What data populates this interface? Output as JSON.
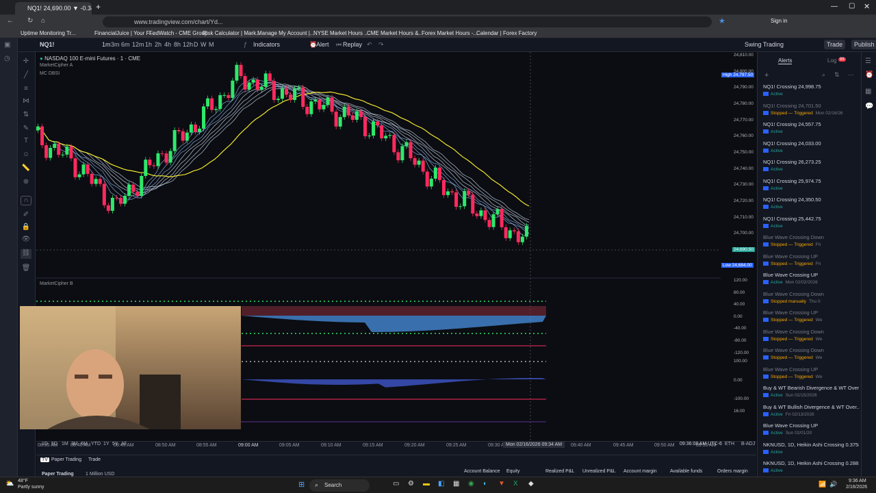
{
  "browser": {
    "tab_title": "NQ1! 24,690.00 ▼ -0.34% Swi...",
    "url": "www.tradingview.com/chart/Yd...",
    "bookmarks": [
      "Uptime Monitoring Tr...",
      "FinancialJuice | Your Fi...",
      "FedWatch - CME Group",
      "Risk Calculator | Mark...",
      "Manage My Account |...",
      "NYSE Market Hours ...",
      "CME Market Hours &...",
      "Forex Market Hours -...",
      "Calendar | Forex Factory"
    ],
    "signin": "Sign in"
  },
  "toolbar": {
    "symbol": "NQ1!",
    "timeframes": [
      "1m",
      "3m",
      "6m",
      "12m",
      "1h",
      "2h",
      "4h",
      "8h",
      "12h",
      "D",
      "W",
      "M"
    ],
    "indicators": "Indicators",
    "alert": "Alert",
    "replay": "Replay",
    "layout_name": "Swing Trading",
    "trade": "Trade",
    "publish": "Publish"
  },
  "chart": {
    "title": "NASDAQ 100 E-mini Futures · 1 · CME",
    "indicator_a": "MarketCipher A",
    "indicator_mc": "MC DBSI",
    "indicator_b": "MarketCipher B",
    "price_labels": [
      "24,810.00",
      "24,800.00",
      "24,790.00",
      "24,780.00",
      "24,770.00",
      "24,760.00",
      "24,750.00",
      "24,740.00",
      "24,730.00",
      "24,720.00",
      "24,710.00",
      "24,700.00",
      "24,690.00",
      "24,684.00"
    ],
    "high_label": "High",
    "high_value": "24,797.50",
    "low_label": "Low",
    "low_value": "24,684.00",
    "current_price": "24,690.50",
    "osc_labels": [
      "120.00",
      "80.00",
      "40.00",
      "0.00",
      "-40.00",
      "-80.00",
      "-120.00",
      "100.00",
      "0.00",
      "-100.00",
      "16.00"
    ],
    "time_labels": [
      "08:35 AM",
      "08:40 AM",
      "08:45 AM",
      "08:50 AM",
      "08:55 AM",
      "09:00 AM",
      "09:05 AM",
      "09:10 AM",
      "09:15 AM",
      "09:20 AM",
      "09:25 AM",
      "09:30 AM",
      "09:40 AM",
      "09:45 AM",
      "09:50 AM",
      "09:55 AM"
    ],
    "crosshair_time": "Mon 02/16/2026   09:34 AM",
    "clock": "09:36:08 AM UTC-6",
    "session": "ETH",
    "adj": "B-ADJ"
  },
  "chart_data": {
    "type": "line",
    "title": "NASDAQ 100 E-mini Futures · 1 · CME",
    "x": [
      "08:35",
      "08:40",
      "08:45",
      "08:50",
      "08:55",
      "09:00",
      "09:05",
      "09:10",
      "09:15",
      "09:20",
      "09:25",
      "09:30",
      "09:34"
    ],
    "series": [
      {
        "name": "NQ1!",
        "values": [
          24760,
          24742,
          24712,
          24745,
          24770,
          24800,
          24790,
          24780,
          24770,
          24750,
          24724,
          24706,
          24690
        ]
      }
    ],
    "ylim": [
      24680,
      24815
    ]
  },
  "bottom": {
    "ranges": [
      "1D",
      "5D",
      "1M",
      "3M",
      "6M",
      "YTD",
      "1Y",
      "5Y",
      "All"
    ],
    "paper_trading": "Paper Trading",
    "trade_tab": "Trade",
    "account_cols": [
      "Account Balance",
      "Equity",
      "Realized P&L",
      "Unrealized P&L",
      "Account margin",
      "Available funds",
      "Orders margin"
    ],
    "account_name": "Paper Trading",
    "account_sub": "1 Million USD"
  },
  "alerts_panel": {
    "tab_alerts": "Alerts",
    "tab_log": "Log",
    "items": [
      {
        "title": "NQ1! Crossing 24,998.75",
        "status": "Active",
        "dim": false,
        "date": ""
      },
      {
        "title": "NQ1! Crossing 24,701.50",
        "status": "Stopped — Triggered",
        "dim": true,
        "date": "Mon 02/16/26"
      },
      {
        "title": "NQ1! Crossing 24,557.75",
        "status": "Active",
        "dim": false,
        "date": ""
      },
      {
        "title": "NQ1! Crossing 24,033.00",
        "status": "Active",
        "dim": false,
        "date": ""
      },
      {
        "title": "NQ1! Crossing 26,273.25",
        "status": "Active",
        "dim": false,
        "date": ""
      },
      {
        "title": "NQ1! Crossing 25,974.75",
        "status": "Active",
        "dim": false,
        "date": ""
      },
      {
        "title": "NQ1! Crossing 24,350.50",
        "status": "Active",
        "dim": false,
        "date": ""
      },
      {
        "title": "NQ1! Crossing 25,442.75",
        "status": "Active",
        "dim": false,
        "date": ""
      },
      {
        "title": "Blue Wave Crossing Down",
        "status": "Stopped — Triggered",
        "dim": true,
        "date": "Fri"
      },
      {
        "title": "Blue Wave Crossing UP",
        "status": "Stopped — Triggered",
        "dim": true,
        "date": "Fri"
      },
      {
        "title": "Blue Wave Crossing UP",
        "status": "Active",
        "dim": false,
        "date": "Mon 02/02/2026"
      },
      {
        "title": "Blue Wave Crossing Down",
        "status": "Stopped manually",
        "dim": true,
        "date": "Thu 0"
      },
      {
        "title": "Blue Wave Crossing UP",
        "status": "Stopped — Triggered",
        "dim": true,
        "date": "We"
      },
      {
        "title": "Blue Wave Crossing Down",
        "status": "Stopped — Triggered",
        "dim": true,
        "date": "We"
      },
      {
        "title": "Blue Wave Crossing Down",
        "status": "Stopped — Triggered",
        "dim": true,
        "date": "We"
      },
      {
        "title": "Blue Wave Crossing UP",
        "status": "Stopped — Triggered",
        "dim": true,
        "date": "We"
      },
      {
        "title": "Buy & WT Bearish Divergence & WT Over...",
        "status": "Active",
        "dim": false,
        "date": "Sun 02/15/2026"
      },
      {
        "title": "Buy & WT Bullish Divergence & WT Over...",
        "status": "Active",
        "dim": false,
        "date": "Fri 02/13/2026"
      },
      {
        "title": "Blue Wave Crossing UP",
        "status": "Active",
        "dim": false,
        "date": "Sun 02/01/20"
      },
      {
        "title": "NKNUSD, 1D, Heikin Ashi Crossing 0.3758",
        "status": "Active",
        "dim": false,
        "date": ""
      },
      {
        "title": "NKNUSD, 1D, Heikin Ashi Crossing 0.2883",
        "status": "Active",
        "dim": false,
        "date": ""
      }
    ]
  },
  "taskbar": {
    "weather_temp": "48°F",
    "weather_desc": "Partly sunny",
    "search": "Search",
    "time": "9:36 AM",
    "date": "2/16/2026"
  },
  "colors": {
    "bull": "#26a69a",
    "bear": "#ef5350",
    "bull_bright": "#2ee86b",
    "bear_bright": "#ff2a5f",
    "yellow": "#f2e62d",
    "blue_wave": "#4a90e2"
  }
}
